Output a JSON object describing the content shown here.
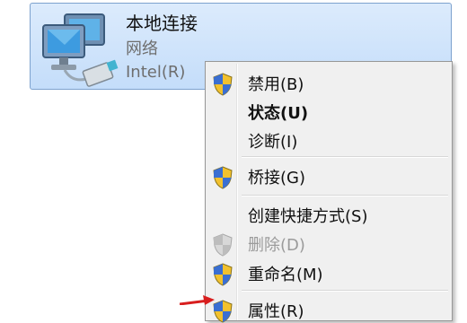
{
  "connection": {
    "title": "本地连接",
    "subtitle": "网络",
    "adapter": "Intel(R)"
  },
  "context_menu": {
    "items": [
      {
        "label": "禁用(B)",
        "icon": "shield-icon",
        "style": "normal"
      },
      {
        "label": "状态(U)",
        "icon": null,
        "style": "bold"
      },
      {
        "label": "诊断(I)",
        "icon": null,
        "style": "normal"
      },
      {
        "label": "桥接(G)",
        "icon": "shield-icon",
        "style": "normal"
      },
      {
        "label": "创建快捷方式(S)",
        "icon": null,
        "style": "normal"
      },
      {
        "label": "删除(D)",
        "icon": "shield-icon",
        "style": "disabled"
      },
      {
        "label": "重命名(M)",
        "icon": "shield-icon",
        "style": "normal"
      },
      {
        "label": "属性(R)",
        "icon": "shield-icon",
        "style": "normal"
      }
    ]
  },
  "colors": {
    "tile_bg": "#c4ddfa",
    "tile_border": "#7da2ce",
    "menu_bg": "#f0f0f0",
    "arrow": "#d81e1e"
  }
}
